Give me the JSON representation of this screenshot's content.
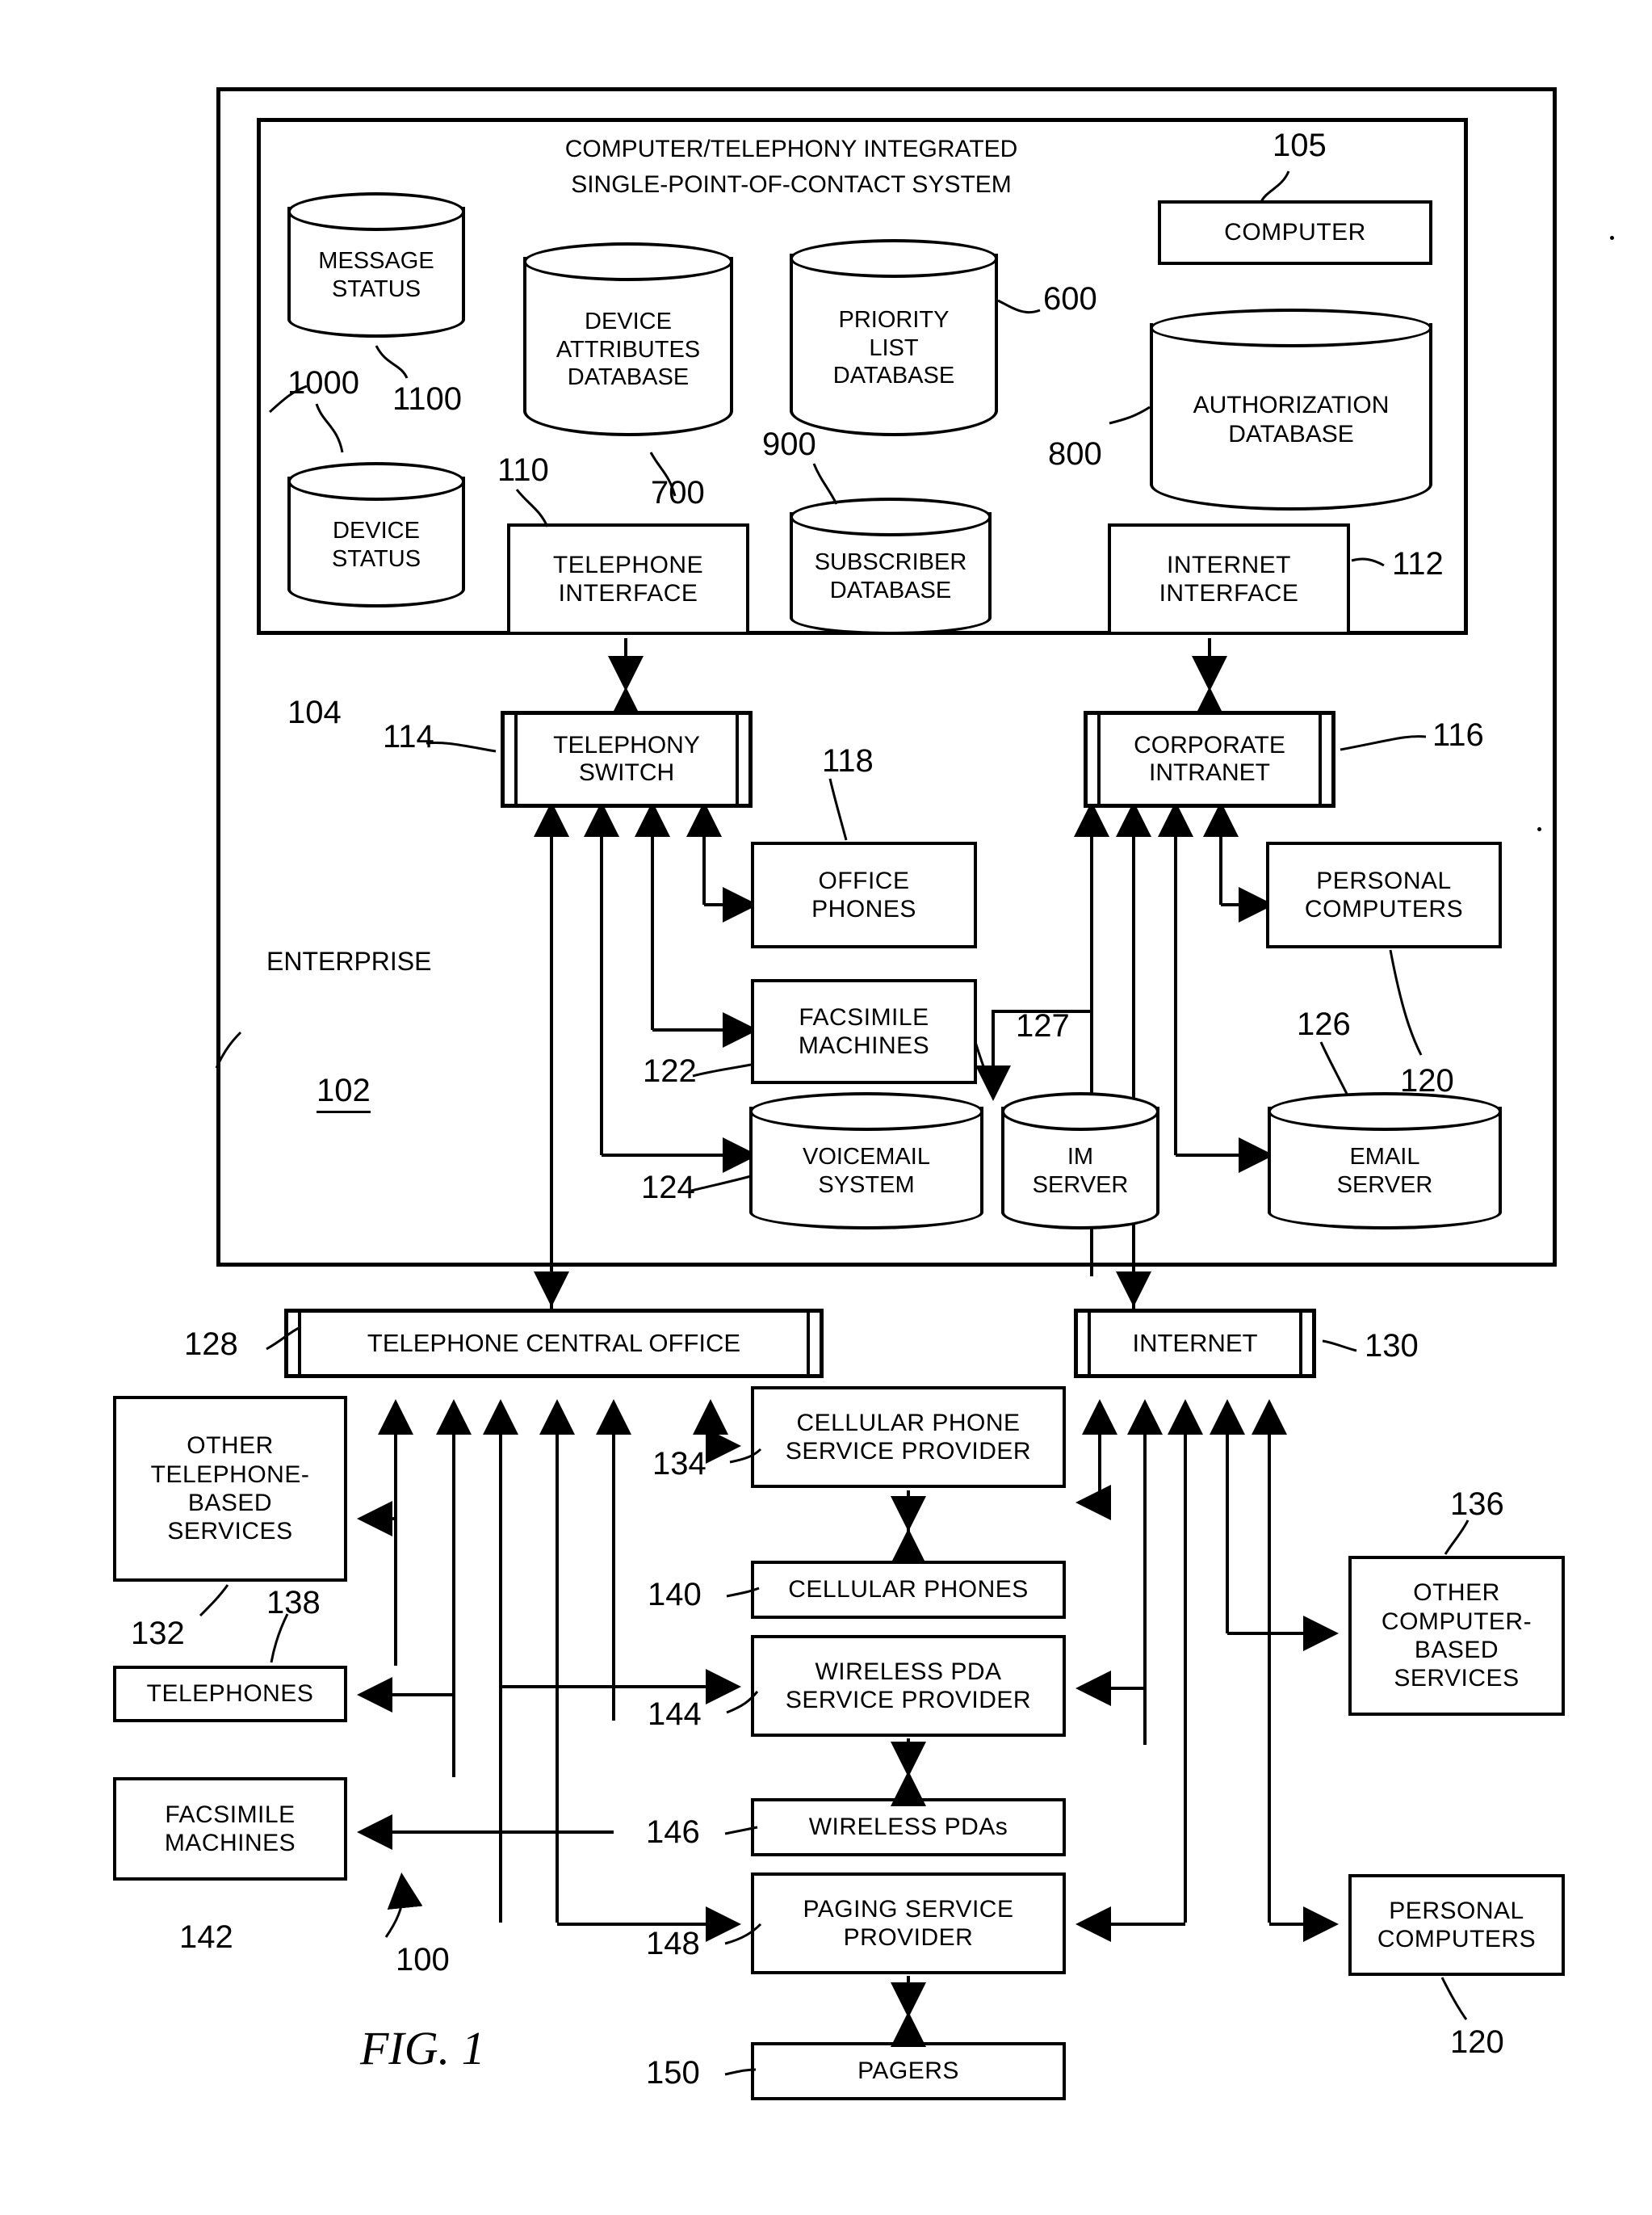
{
  "figure": {
    "label": "FIG. 1",
    "system_ref": "100"
  },
  "enterprise": {
    "title": "ENTERPRISE",
    "ref": "102"
  },
  "spoc": {
    "title_line1": "COMPUTER/TELEPHONY INTEGRATED",
    "title_line2": "SINGLE-POINT-OF-CONTACT SYSTEM",
    "ref": "104"
  },
  "nodes": {
    "message_status": {
      "label": "MESSAGE\nSTATUS",
      "ref": "1100"
    },
    "device_status": {
      "label": "DEVICE\nSTATUS",
      "ref": "1000"
    },
    "device_attributes_db": {
      "label": "DEVICE\nATTRIBUTES\nDATABASE",
      "ref": "700"
    },
    "priority_list_db": {
      "label": "PRIORITY\nLIST\nDATABASE",
      "ref": "600"
    },
    "subscriber_db": {
      "label": "SUBSCRIBER\nDATABASE",
      "ref": "900"
    },
    "authorization_db": {
      "label": "AUTHORIZATION\nDATABASE",
      "ref": "800"
    },
    "computer": {
      "label": "COMPUTER",
      "ref": "105"
    },
    "telephone_interface": {
      "label": "TELEPHONE\nINTERFACE",
      "ref": "110"
    },
    "internet_interface": {
      "label": "INTERNET\nINTERFACE",
      "ref": "112"
    },
    "telephony_switch": {
      "label": "TELEPHONY\nSWITCH",
      "ref": "114"
    },
    "corporate_intranet": {
      "label": "CORPORATE\nINTRANET",
      "ref": "116"
    },
    "office_phones": {
      "label": "OFFICE\nPHONES",
      "ref": "118"
    },
    "facsimile_machines_ent": {
      "label": "FACSIMILE\nMACHINES",
      "ref": "122"
    },
    "voicemail_system": {
      "label": "VOICEMAIL\nSYSTEM",
      "ref": "124"
    },
    "im_server": {
      "label": "IM\nSERVER",
      "ref": "127"
    },
    "email_server": {
      "label": "EMAIL\nSERVER",
      "ref": "126"
    },
    "personal_computers_ent": {
      "label": "PERSONAL\nCOMPUTERS",
      "ref": "120"
    },
    "telephone_central_office": {
      "label": "TELEPHONE CENTRAL OFFICE",
      "ref": "128"
    },
    "internet": {
      "label": "INTERNET",
      "ref": "130"
    },
    "other_telephone_services": {
      "label": "OTHER\nTELEPHONE-\nBASED\nSERVICES",
      "ref": "132"
    },
    "telephones": {
      "label": "TELEPHONES",
      "ref": "138"
    },
    "facsimile_machines_ext": {
      "label": "FACSIMILE\nMACHINES",
      "ref": "142"
    },
    "cellular_phone_service_provider": {
      "label": "CELLULAR PHONE\nSERVICE PROVIDER",
      "ref": "134"
    },
    "cellular_phones": {
      "label": "CELLULAR PHONES",
      "ref": "140"
    },
    "wireless_pda_service_provider": {
      "label": "WIRELESS PDA\nSERVICE PROVIDER",
      "ref": "144"
    },
    "wireless_pdas": {
      "label": "WIRELESS PDAs",
      "ref": "146"
    },
    "paging_service_provider": {
      "label": "PAGING SERVICE\nPROVIDER",
      "ref": "148"
    },
    "pagers": {
      "label": "PAGERS",
      "ref": "150"
    },
    "other_computer_services": {
      "label": "OTHER\nCOMPUTER-\nBASED\nSERVICES",
      "ref": "136"
    },
    "personal_computers_ext": {
      "label": "PERSONAL\nCOMPUTERS",
      "ref": "120"
    }
  }
}
